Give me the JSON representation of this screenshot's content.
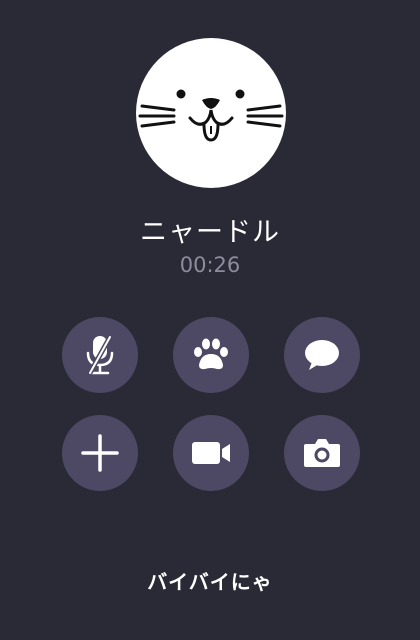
{
  "caller": {
    "name": "ニャードル",
    "duration": "00:26",
    "avatar_icon": "seal-face-icon"
  },
  "controls": [
    {
      "icon": "microphone-muted-icon"
    },
    {
      "icon": "paw-icon"
    },
    {
      "icon": "speech-bubble-icon"
    },
    {
      "icon": "plus-icon"
    },
    {
      "icon": "video-camera-icon"
    },
    {
      "icon": "camera-icon"
    }
  ],
  "end_call": {
    "label": "バイバイにゃ"
  },
  "colors": {
    "background": "#2a2a36",
    "button": "#4d4863",
    "timer_text": "#8e8c9c",
    "text": "#ffffff"
  }
}
